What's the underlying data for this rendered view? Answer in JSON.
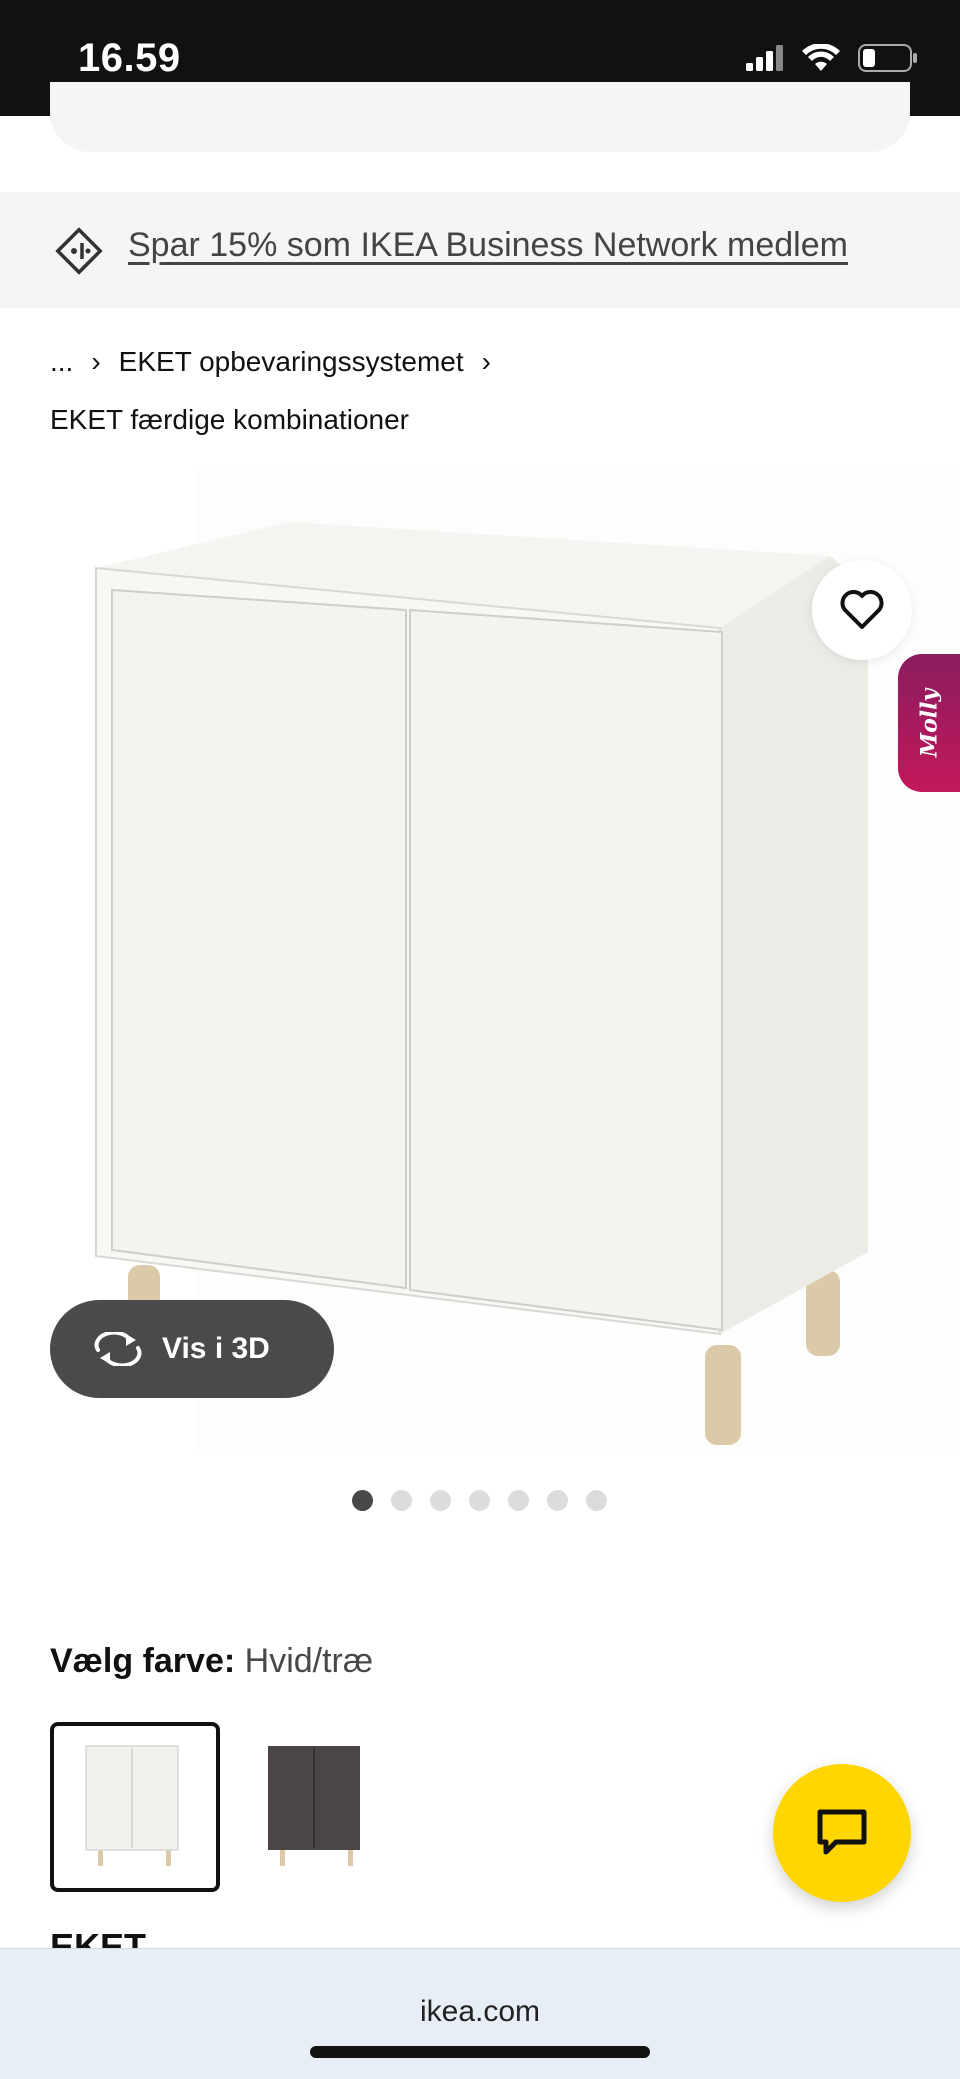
{
  "status_bar": {
    "time": "16.59"
  },
  "promo": {
    "text": "Spar 15% som IKEA Business Network medlem"
  },
  "breadcrumb": {
    "ellipsis": "...",
    "items": [
      "EKET opbevaringssystemet",
      "EKET færdige kombinationer"
    ]
  },
  "product": {
    "view_3d_label": "Vis i 3D",
    "molly_label": "Molly",
    "gallery_count": 7,
    "gallery_active_index": 0
  },
  "color_picker": {
    "label": "Vælg farve:",
    "selected_value": "Hvid/træ",
    "swatches": [
      {
        "name": "white",
        "color": "#f4f3ef",
        "selected": true
      },
      {
        "name": "dark-grey",
        "color": "#4b4545",
        "selected": false
      }
    ]
  },
  "product_name_partial": "EKET",
  "browser": {
    "url": "ikea.com"
  },
  "colors": {
    "accent_yellow": "#ffd600",
    "status_bar": "#111111",
    "molly": "#c2185b"
  }
}
